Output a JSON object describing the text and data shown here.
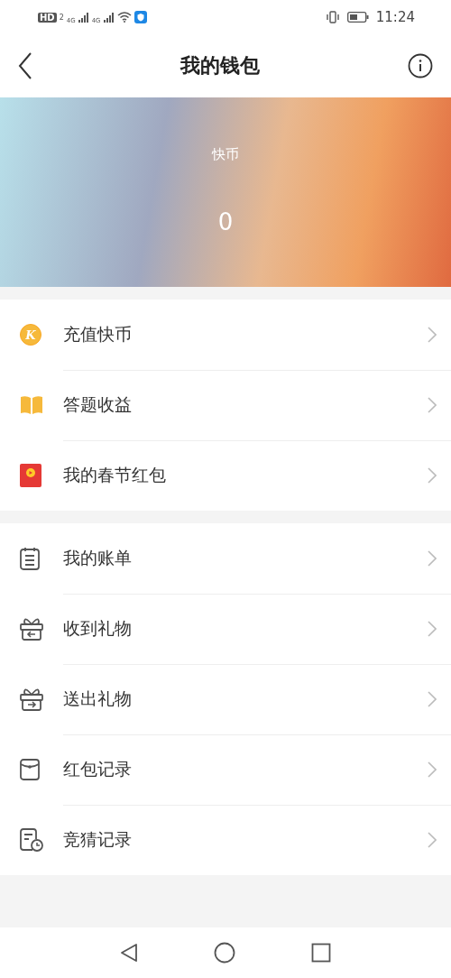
{
  "status_bar": {
    "hd": "HD",
    "hd_sub": "2",
    "networks": [
      "4G",
      "4G"
    ],
    "time": "11:24"
  },
  "header": {
    "title": "我的钱包"
  },
  "balance": {
    "label": "快币",
    "value": "0"
  },
  "groups": [
    {
      "items": [
        {
          "kind": "coin",
          "icon_text": "K",
          "label": "充值快币"
        },
        {
          "kind": "book",
          "label": "答题收益"
        },
        {
          "kind": "redpacket",
          "label": "我的春节红包"
        }
      ]
    },
    {
      "items": [
        {
          "kind": "calendar",
          "label": "我的账单"
        },
        {
          "kind": "gift-in",
          "label": "收到礼物"
        },
        {
          "kind": "gift-out",
          "label": "送出礼物"
        },
        {
          "kind": "envelope",
          "label": "红包记录"
        },
        {
          "kind": "bill-clock",
          "label": "竞猜记录"
        }
      ]
    }
  ]
}
